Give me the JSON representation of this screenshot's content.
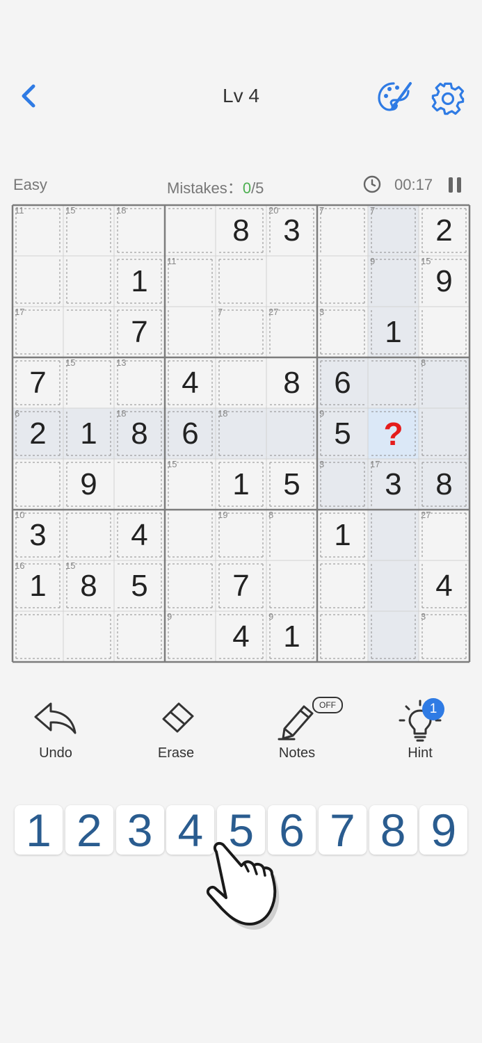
{
  "header": {
    "title": "Lv 4"
  },
  "status": {
    "difficulty": "Easy",
    "mistakes_label": "Mistakes：",
    "mistakes_count": "0",
    "mistakes_max": "/5",
    "time": "00:17"
  },
  "board": {
    "grid": [
      [
        "",
        "",
        "",
        "",
        "8",
        "3",
        "",
        "",
        "2"
      ],
      [
        "",
        "",
        "1",
        "",
        "",
        "",
        "",
        "",
        "9"
      ],
      [
        "",
        "",
        "7",
        "",
        "",
        "",
        "",
        "1",
        ""
      ],
      [
        "7",
        "",
        "",
        "4",
        "",
        "8",
        "6",
        "",
        ""
      ],
      [
        "2",
        "1",
        "8",
        "6",
        "",
        "",
        "5",
        "?",
        ""
      ],
      [
        "",
        "9",
        "",
        "",
        "1",
        "5",
        "",
        "3",
        "8"
      ],
      [
        "3",
        "",
        "4",
        "",
        "",
        "",
        "1",
        "",
        ""
      ],
      [
        "1",
        "8",
        "5",
        "",
        "7",
        "",
        "",
        "",
        "4"
      ],
      [
        "",
        "",
        "",
        "",
        "4",
        "1",
        "",
        "",
        ""
      ]
    ],
    "selected": [
      4,
      7
    ],
    "cages": [
      {
        "sum": "11",
        "cells": [
          [
            0,
            0
          ],
          [
            1,
            0
          ]
        ]
      },
      {
        "sum": "15",
        "cells": [
          [
            0,
            1
          ],
          [
            1,
            1
          ]
        ]
      },
      {
        "sum": "18",
        "cells": [
          [
            0,
            2
          ],
          [
            0,
            3
          ],
          [
            0,
            4
          ]
        ]
      },
      {
        "sum": "20",
        "cells": [
          [
            0,
            5
          ],
          [
            1,
            5
          ],
          [
            1,
            4
          ]
        ]
      },
      {
        "sum": "7",
        "cells": [
          [
            0,
            6
          ],
          [
            1,
            6
          ]
        ]
      },
      {
        "sum": "7",
        "cells": [
          [
            0,
            7
          ]
        ]
      },
      {
        "sum": "",
        "cells": [
          [
            0,
            8
          ]
        ]
      },
      {
        "sum": "",
        "cells": [
          [
            1,
            2
          ]
        ]
      },
      {
        "sum": "11",
        "cells": [
          [
            1,
            3
          ],
          [
            2,
            3
          ]
        ]
      },
      {
        "sum": "9",
        "cells": [
          [
            1,
            7
          ],
          [
            2,
            7
          ]
        ]
      },
      {
        "sum": "15",
        "cells": [
          [
            1,
            8
          ],
          [
            2,
            8
          ]
        ]
      },
      {
        "sum": "17",
        "cells": [
          [
            2,
            0
          ],
          [
            2,
            1
          ]
        ]
      },
      {
        "sum": "",
        "cells": [
          [
            2,
            2
          ]
        ]
      },
      {
        "sum": "7",
        "cells": [
          [
            2,
            4
          ]
        ]
      },
      {
        "sum": "27",
        "cells": [
          [
            2,
            5
          ],
          [
            3,
            5
          ],
          [
            3,
            4
          ]
        ]
      },
      {
        "sum": "3",
        "cells": [
          [
            2,
            6
          ]
        ]
      },
      {
        "sum": "",
        "cells": [
          [
            3,
            0
          ]
        ]
      },
      {
        "sum": "15",
        "cells": [
          [
            3,
            1
          ],
          [
            4,
            1
          ]
        ]
      },
      {
        "sum": "13",
        "cells": [
          [
            3,
            2
          ]
        ]
      },
      {
        "sum": "",
        "cells": [
          [
            3,
            3
          ]
        ]
      },
      {
        "sum": "",
        "cells": [
          [
            3,
            6
          ],
          [
            3,
            7
          ]
        ]
      },
      {
        "sum": "8",
        "cells": [
          [
            3,
            8
          ],
          [
            4,
            8
          ]
        ]
      },
      {
        "sum": "6",
        "cells": [
          [
            4,
            0
          ]
        ]
      },
      {
        "sum": "18",
        "cells": [
          [
            4,
            2
          ]
        ]
      },
      {
        "sum": "",
        "cells": [
          [
            4,
            3
          ]
        ]
      },
      {
        "sum": "18",
        "cells": [
          [
            4,
            4
          ],
          [
            4,
            5
          ]
        ]
      },
      {
        "sum": "9",
        "cells": [
          [
            4,
            6
          ],
          [
            4,
            7
          ]
        ]
      },
      {
        "sum": "",
        "cells": [
          [
            5,
            0
          ],
          [
            6,
            1
          ]
        ]
      },
      {
        "sum": "",
        "cells": [
          [
            5,
            1
          ],
          [
            5,
            2
          ]
        ]
      },
      {
        "sum": "15",
        "cells": [
          [
            5,
            3
          ],
          [
            6,
            3
          ]
        ]
      },
      {
        "sum": "",
        "cells": [
          [
            5,
            4
          ]
        ]
      },
      {
        "sum": "",
        "cells": [
          [
            5,
            5
          ]
        ]
      },
      {
        "sum": "3",
        "cells": [
          [
            5,
            6
          ]
        ]
      },
      {
        "sum": "17",
        "cells": [
          [
            5,
            7
          ],
          [
            6,
            7
          ],
          [
            7,
            7
          ],
          [
            8,
            7
          ]
        ]
      },
      {
        "sum": "",
        "cells": [
          [
            5,
            8
          ]
        ]
      },
      {
        "sum": "10",
        "cells": [
          [
            6,
            0
          ]
        ]
      },
      {
        "sum": "",
        "cells": [
          [
            6,
            2
          ]
        ]
      },
      {
        "sum": "19",
        "cells": [
          [
            6,
            4
          ]
        ]
      },
      {
        "sum": "8",
        "cells": [
          [
            6,
            5
          ],
          [
            7,
            5
          ]
        ]
      },
      {
        "sum": "",
        "cells": [
          [
            6,
            6
          ]
        ]
      },
      {
        "sum": "27",
        "cells": [
          [
            6,
            8
          ],
          [
            7,
            8
          ]
        ]
      },
      {
        "sum": "16",
        "cells": [
          [
            7,
            0
          ]
        ]
      },
      {
        "sum": "15",
        "cells": [
          [
            7,
            1
          ],
          [
            7,
            2
          ]
        ]
      },
      {
        "sum": "",
        "cells": [
          [
            7,
            3
          ]
        ]
      },
      {
        "sum": "",
        "cells": [
          [
            7,
            4
          ]
        ]
      },
      {
        "sum": "",
        "cells": [
          [
            7,
            6
          ]
        ]
      },
      {
        "sum": "",
        "cells": [
          [
            8,
            0
          ],
          [
            8,
            1
          ]
        ]
      },
      {
        "sum": "",
        "cells": [
          [
            8,
            2
          ]
        ]
      },
      {
        "sum": "9",
        "cells": [
          [
            8,
            3
          ],
          [
            8,
            4
          ]
        ]
      },
      {
        "sum": "9",
        "cells": [
          [
            8,
            5
          ]
        ]
      },
      {
        "sum": "",
        "cells": [
          [
            8,
            6
          ]
        ]
      },
      {
        "sum": "3",
        "cells": [
          [
            8,
            8
          ]
        ]
      }
    ]
  },
  "tools": {
    "undo": "Undo",
    "erase": "Erase",
    "notes": "Notes",
    "notes_state": "OFF",
    "hint": "Hint",
    "hint_count": "1"
  },
  "numpad": [
    "1",
    "2",
    "3",
    "4",
    "5",
    "6",
    "7",
    "8",
    "9"
  ],
  "icons": {
    "back": "back-chevron-icon",
    "theme": "palette-brush-icon",
    "settings": "gear-icon",
    "clock": "clock-icon",
    "pause": "pause-icon",
    "undo": "undo-arrow-icon",
    "erase": "eraser-icon",
    "notes": "pencil-icon",
    "hint": "lightbulb-icon",
    "hand": "pointing-hand-icon"
  },
  "colors": {
    "accent": "#2f7be4",
    "digit_pad": "#2a5c8f",
    "question": "#e51c1c",
    "mistakes_ok": "#4caf50",
    "highlight": "#e6e9ee",
    "selected": "#dbe8f7"
  }
}
